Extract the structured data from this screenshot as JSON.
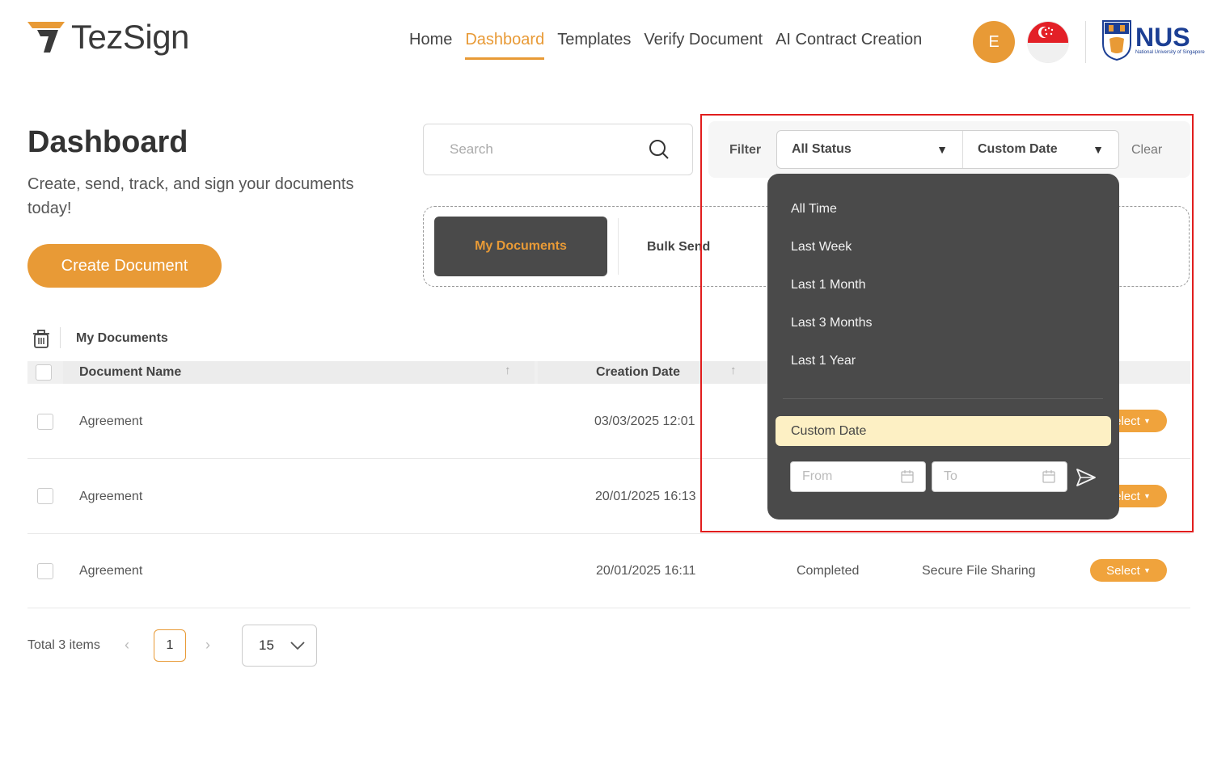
{
  "header": {
    "logo_text": "TezSign",
    "nav": [
      "Home",
      "Dashboard",
      "Templates",
      "Verify Document",
      "AI Contract Creation"
    ],
    "active_nav": "Dashboard",
    "avatar_initial": "E",
    "partner_logo_main": "NUS",
    "partner_logo_sub": "National University of Singapore"
  },
  "page": {
    "title": "Dashboard",
    "subtitle": "Create, send, track, and sign your documents today!",
    "create_button": "Create Document"
  },
  "search": {
    "placeholder": "Search"
  },
  "tabs": {
    "my_documents": "My Documents",
    "bulk_send": "Bulk Send"
  },
  "filter": {
    "label": "Filter",
    "status_value": "All Status",
    "date_value": "Custom Date",
    "clear": "Clear"
  },
  "dropdown": {
    "options": [
      "All Time",
      "Last Week",
      "Last 1 Month",
      "Last 3 Months",
      "Last 1 Year"
    ],
    "selected": "Custom Date",
    "from_placeholder": "From",
    "to_placeholder": "To"
  },
  "table": {
    "title": "My Documents",
    "columns": [
      "Document Name",
      "Creation Date"
    ],
    "rows": [
      {
        "name": "Agreement",
        "date": "03/03/2025 12:01",
        "status": "",
        "type": "",
        "action": "Select"
      },
      {
        "name": "Agreement",
        "date": "20/01/2025 16:13",
        "status": "",
        "type": "",
        "action": "Select"
      },
      {
        "name": "Agreement",
        "date": "20/01/2025 16:11",
        "status": "Completed",
        "type": "Secure File Sharing",
        "action": "Select"
      }
    ],
    "partial_action_text": "lect"
  },
  "pagination": {
    "total": "Total 3 items",
    "current_page": "1",
    "page_size": "15"
  },
  "colors": {
    "accent": "#E89A36",
    "dark_panel": "#4a4a4a",
    "highlight": "#e11d1d"
  }
}
